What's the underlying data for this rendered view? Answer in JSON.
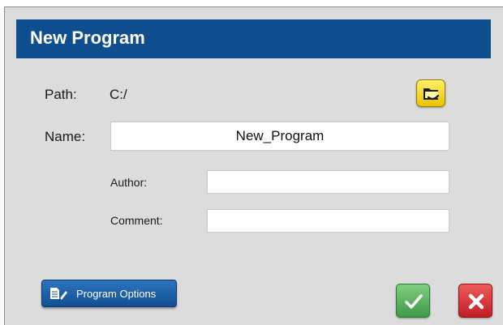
{
  "dialog": {
    "title": "New Program"
  },
  "path": {
    "label": "Path:",
    "value": "C:/",
    "browse_icon": "folder-open-icon"
  },
  "name": {
    "label": "Name:",
    "value": "New_Program"
  },
  "author": {
    "label": "Author:",
    "value": ""
  },
  "comment": {
    "label": "Comment:",
    "value": ""
  },
  "buttons": {
    "options_label": "Program Options",
    "options_icon": "edit-document-icon",
    "ok_icon": "checkmark-icon",
    "cancel_icon": "close-x-icon"
  },
  "colors": {
    "title_bar": "#104f8f",
    "background": "#dcdcdc",
    "ok": "#4fae58",
    "cancel": "#d3262c",
    "browse": "#f5dd1f"
  }
}
